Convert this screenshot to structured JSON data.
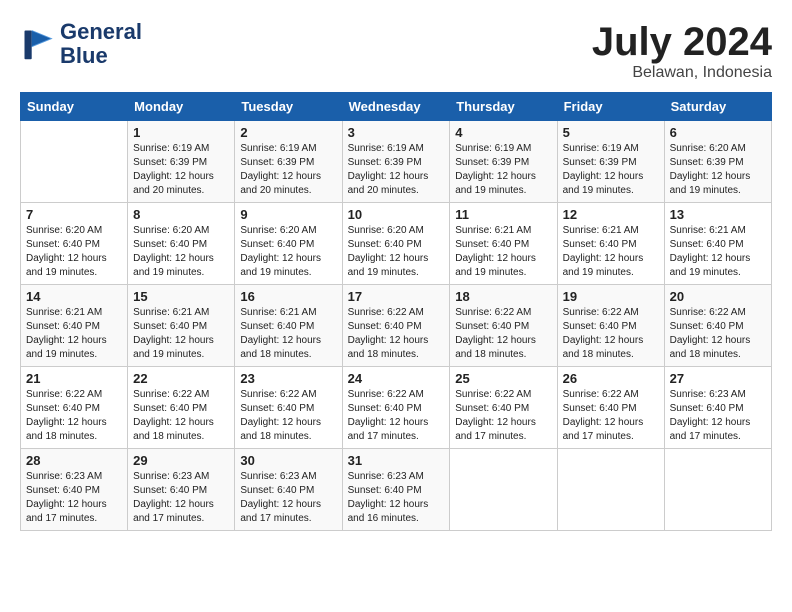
{
  "header": {
    "logo_line1": "General",
    "logo_line2": "Blue",
    "month_title": "July 2024",
    "location": "Belawan, Indonesia"
  },
  "weekdays": [
    "Sunday",
    "Monday",
    "Tuesday",
    "Wednesday",
    "Thursday",
    "Friday",
    "Saturday"
  ],
  "weeks": [
    [
      {
        "day": "",
        "info": ""
      },
      {
        "day": "1",
        "info": "Sunrise: 6:19 AM\nSunset: 6:39 PM\nDaylight: 12 hours\nand 20 minutes."
      },
      {
        "day": "2",
        "info": "Sunrise: 6:19 AM\nSunset: 6:39 PM\nDaylight: 12 hours\nand 20 minutes."
      },
      {
        "day": "3",
        "info": "Sunrise: 6:19 AM\nSunset: 6:39 PM\nDaylight: 12 hours\nand 20 minutes."
      },
      {
        "day": "4",
        "info": "Sunrise: 6:19 AM\nSunset: 6:39 PM\nDaylight: 12 hours\nand 19 minutes."
      },
      {
        "day": "5",
        "info": "Sunrise: 6:19 AM\nSunset: 6:39 PM\nDaylight: 12 hours\nand 19 minutes."
      },
      {
        "day": "6",
        "info": "Sunrise: 6:20 AM\nSunset: 6:39 PM\nDaylight: 12 hours\nand 19 minutes."
      }
    ],
    [
      {
        "day": "7",
        "info": "Sunrise: 6:20 AM\nSunset: 6:40 PM\nDaylight: 12 hours\nand 19 minutes."
      },
      {
        "day": "8",
        "info": "Sunrise: 6:20 AM\nSunset: 6:40 PM\nDaylight: 12 hours\nand 19 minutes."
      },
      {
        "day": "9",
        "info": "Sunrise: 6:20 AM\nSunset: 6:40 PM\nDaylight: 12 hours\nand 19 minutes."
      },
      {
        "day": "10",
        "info": "Sunrise: 6:20 AM\nSunset: 6:40 PM\nDaylight: 12 hours\nand 19 minutes."
      },
      {
        "day": "11",
        "info": "Sunrise: 6:21 AM\nSunset: 6:40 PM\nDaylight: 12 hours\nand 19 minutes."
      },
      {
        "day": "12",
        "info": "Sunrise: 6:21 AM\nSunset: 6:40 PM\nDaylight: 12 hours\nand 19 minutes."
      },
      {
        "day": "13",
        "info": "Sunrise: 6:21 AM\nSunset: 6:40 PM\nDaylight: 12 hours\nand 19 minutes."
      }
    ],
    [
      {
        "day": "14",
        "info": "Sunrise: 6:21 AM\nSunset: 6:40 PM\nDaylight: 12 hours\nand 19 minutes."
      },
      {
        "day": "15",
        "info": "Sunrise: 6:21 AM\nSunset: 6:40 PM\nDaylight: 12 hours\nand 19 minutes."
      },
      {
        "day": "16",
        "info": "Sunrise: 6:21 AM\nSunset: 6:40 PM\nDaylight: 12 hours\nand 18 minutes."
      },
      {
        "day": "17",
        "info": "Sunrise: 6:22 AM\nSunset: 6:40 PM\nDaylight: 12 hours\nand 18 minutes."
      },
      {
        "day": "18",
        "info": "Sunrise: 6:22 AM\nSunset: 6:40 PM\nDaylight: 12 hours\nand 18 minutes."
      },
      {
        "day": "19",
        "info": "Sunrise: 6:22 AM\nSunset: 6:40 PM\nDaylight: 12 hours\nand 18 minutes."
      },
      {
        "day": "20",
        "info": "Sunrise: 6:22 AM\nSunset: 6:40 PM\nDaylight: 12 hours\nand 18 minutes."
      }
    ],
    [
      {
        "day": "21",
        "info": "Sunrise: 6:22 AM\nSunset: 6:40 PM\nDaylight: 12 hours\nand 18 minutes."
      },
      {
        "day": "22",
        "info": "Sunrise: 6:22 AM\nSunset: 6:40 PM\nDaylight: 12 hours\nand 18 minutes."
      },
      {
        "day": "23",
        "info": "Sunrise: 6:22 AM\nSunset: 6:40 PM\nDaylight: 12 hours\nand 18 minutes."
      },
      {
        "day": "24",
        "info": "Sunrise: 6:22 AM\nSunset: 6:40 PM\nDaylight: 12 hours\nand 17 minutes."
      },
      {
        "day": "25",
        "info": "Sunrise: 6:22 AM\nSunset: 6:40 PM\nDaylight: 12 hours\nand 17 minutes."
      },
      {
        "day": "26",
        "info": "Sunrise: 6:22 AM\nSunset: 6:40 PM\nDaylight: 12 hours\nand 17 minutes."
      },
      {
        "day": "27",
        "info": "Sunrise: 6:23 AM\nSunset: 6:40 PM\nDaylight: 12 hours\nand 17 minutes."
      }
    ],
    [
      {
        "day": "28",
        "info": "Sunrise: 6:23 AM\nSunset: 6:40 PM\nDaylight: 12 hours\nand 17 minutes."
      },
      {
        "day": "29",
        "info": "Sunrise: 6:23 AM\nSunset: 6:40 PM\nDaylight: 12 hours\nand 17 minutes."
      },
      {
        "day": "30",
        "info": "Sunrise: 6:23 AM\nSunset: 6:40 PM\nDaylight: 12 hours\nand 17 minutes."
      },
      {
        "day": "31",
        "info": "Sunrise: 6:23 AM\nSunset: 6:40 PM\nDaylight: 12 hours\nand 16 minutes."
      },
      {
        "day": "",
        "info": ""
      },
      {
        "day": "",
        "info": ""
      },
      {
        "day": "",
        "info": ""
      }
    ]
  ]
}
